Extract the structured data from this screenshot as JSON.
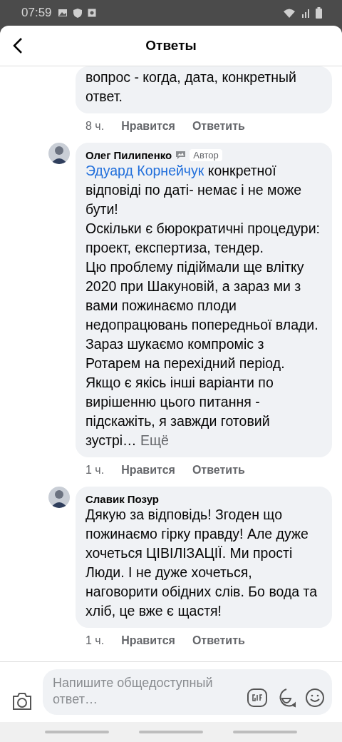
{
  "status_bar": {
    "time": "07:59"
  },
  "header": {
    "title": "Ответы"
  },
  "comments": [
    {
      "paragraphs": [
        "вопрос - когда, дата, конкретный ответ."
      ],
      "time": "8 ч.",
      "like": "Нравится",
      "reply": "Ответить"
    },
    {
      "author": "Олег Пилипенко",
      "badge": "Автор",
      "mention": "Эдуард Корнейчук",
      "paragraphs": [
        "конкретної відповіді по даті- немає і не може бути!",
        "Оскільки є бюрократичні процедури: проект, експертиза, тендер.",
        "Цю проблему підіймали ще влітку 2020 при Шакуновій, а зараз ми з вами пожинаємо плоди недопрацювань попередньої влади.",
        "Зараз шукаємо компроміс з Ротарем на перехідний період.",
        "Якщо є якісь інші варіанти по вирішенню цього питання - підскажіть, я завжди готовий зустрі…"
      ],
      "more": "Ещё",
      "time": "1 ч.",
      "like": "Нравится",
      "reply": "Ответить"
    },
    {
      "author": "Славик Позур",
      "paragraphs": [
        "Дякую за відповідь! Згоден що пожинаємо гірку правду! Але дуже хочеться ЦІВІЛІЗАЦІЇ. Ми прості Люди. І не дуже хочеться, наговорити обідних слів. Бо вода та хліб, це  вже є щастя!"
      ],
      "time": "1 ч.",
      "like": "Нравится",
      "reply": "Ответить"
    }
  ],
  "composer": {
    "placeholder": "Напишите общедоступный ответ…"
  }
}
